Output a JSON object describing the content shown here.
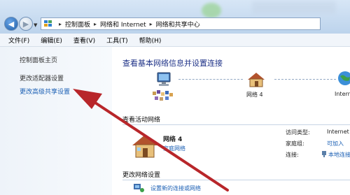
{
  "address_bar": {
    "crumbs": [
      "控制面板",
      "网络和 Internet",
      "网络和共享中心"
    ],
    "separator": "▸"
  },
  "menu": {
    "items": [
      "文件(F)",
      "编辑(E)",
      "查看(V)",
      "工具(T)",
      "帮助(H)"
    ]
  },
  "sidebar": {
    "home": "控制面板主页",
    "adapter": "更改适配器设置",
    "advanced_sharing": "更改高级共享设置"
  },
  "main": {
    "title": "查看基本网络信息并设置连接",
    "map_network_label": "网络 4",
    "map_internet_label": "Intern",
    "active_section": "查看活动网络",
    "network_name": "网络 4",
    "network_type": "家庭网络",
    "access_type_label": "访问类型:",
    "access_type_value": "Internet",
    "homegroup_label": "家庭组:",
    "homegroup_value": "可加入",
    "connection_label": "连接:",
    "connection_value": "本地连接",
    "change_section": "更改网络设置",
    "setup_link": "设置新的连接或网络"
  },
  "colors": {
    "link": "#1a5fb4",
    "title": "#1e3287",
    "arrow": "#b8262a"
  }
}
